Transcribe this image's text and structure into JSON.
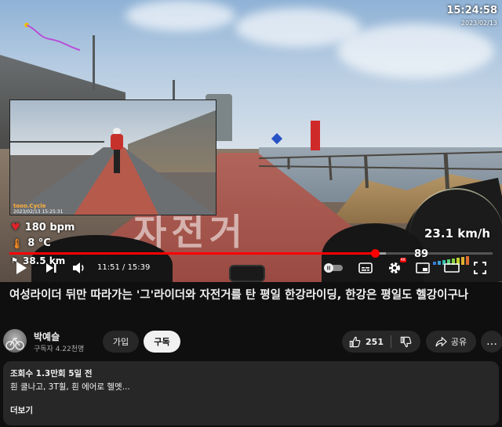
{
  "overlay": {
    "clock": "15:24:58",
    "date": "2023/02/13",
    "heart_rate": "180 bpm",
    "temperature": "8 °C",
    "distance": "38.5 km",
    "speed": "23.1 km/h",
    "cadence": "89",
    "inset_logo": "tooo.Cycle",
    "inset_timestamp": "2023/02/13 15:25:31",
    "road_marking": "자전거"
  },
  "player": {
    "current_time": "11:51",
    "duration": "15:39",
    "progress": 0.757,
    "buffered": 0.78,
    "quality_badge": "4K",
    "colors": {
      "accent": "#ff0000"
    },
    "icons": [
      "play-icon",
      "next-icon",
      "volume-icon",
      "autoplay-toggle-icon",
      "subtitles-icon",
      "settings-icon",
      "miniplayer-icon",
      "theater-icon",
      "fullscreen-icon"
    ]
  },
  "video": {
    "title": "여성라이더 뒤만 따라가는 '그'라이더와 자전거를 탄 평일 한강라이딩, 한강은 평일도 헬강이구나"
  },
  "channel": {
    "name": "박예슬",
    "subscribers": "구독자 4.22천명",
    "join_label": "가입",
    "subscribe_label": "구독"
  },
  "actions": {
    "like_count": "251",
    "share_label": "공유",
    "more_label": "…"
  },
  "description": {
    "meta": "조회수 1.3만회  5일 전",
    "text": "흰 쿨나고, 3T휠, 흰 에어로 헬멧...",
    "more_label": "더보기"
  }
}
